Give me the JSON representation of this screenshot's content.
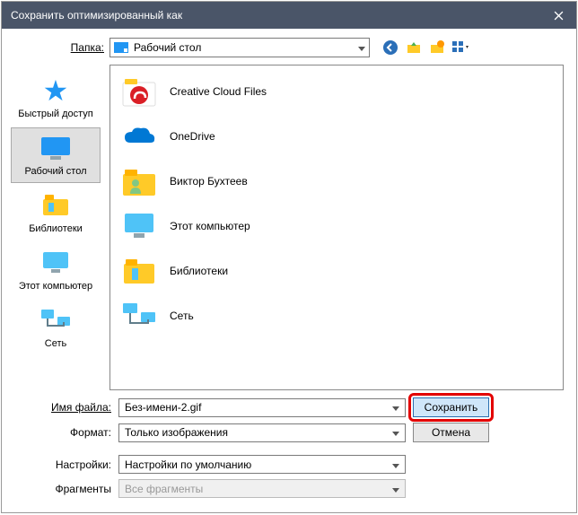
{
  "title": "Сохранить оптимизированный как",
  "toolbar": {
    "folder_label": "Папка:",
    "current_folder": "Рабочий стол"
  },
  "sidebar": {
    "items": [
      {
        "label": "Быстрый доступ"
      },
      {
        "label": "Рабочий стол"
      },
      {
        "label": "Библиотеки"
      },
      {
        "label": "Этот компьютер"
      },
      {
        "label": "Сеть"
      }
    ]
  },
  "file_list": {
    "items": [
      {
        "label": "Creative Cloud Files"
      },
      {
        "label": "OneDrive"
      },
      {
        "label": "Виктор Бухтеев"
      },
      {
        "label": "Этот компьютер"
      },
      {
        "label": "Библиотеки"
      },
      {
        "label": "Сеть"
      }
    ]
  },
  "fields": {
    "filename_label": "Имя файла:",
    "filename_value": "Без-имени-2.gif",
    "format_label": "Формат:",
    "format_value": "Только изображения",
    "settings_label": "Настройки:",
    "settings_value": "Настройки по умолчанию",
    "fragments_label": "Фрагменты",
    "fragments_value": "Все фрагменты"
  },
  "buttons": {
    "save": "Сохранить",
    "cancel": "Отмена"
  }
}
